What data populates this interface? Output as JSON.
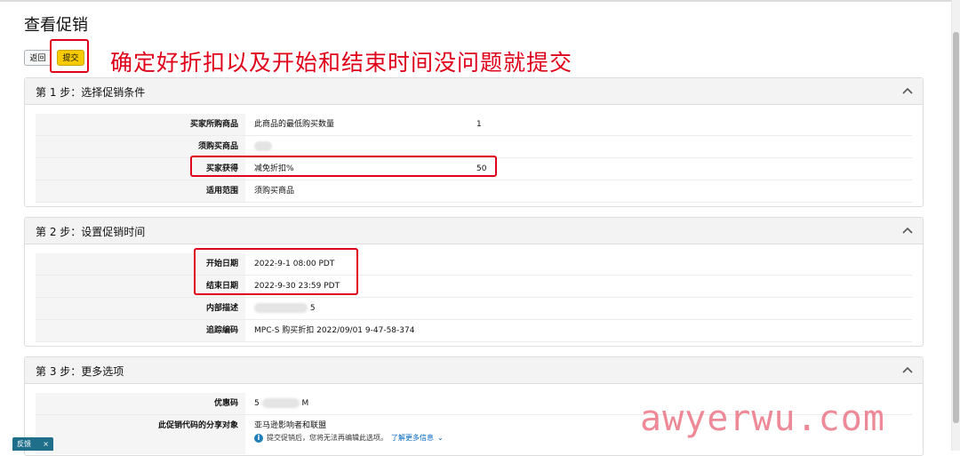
{
  "page": {
    "title": "查看促销",
    "back_label": "返回",
    "submit_label": "提交",
    "annotation": "确定好折扣以及开始和结束时间没问题就提交"
  },
  "step1": {
    "title": "第 1 步：选择促销条件",
    "rows": [
      {
        "label": "买家所购商品",
        "value": "此商品的最低购买数量",
        "value2": "1"
      },
      {
        "label": "须购买商品",
        "value": "",
        "value2": ""
      },
      {
        "label": "买家获得",
        "value": "减免折扣%",
        "value2": "50"
      },
      {
        "label": "适用范围",
        "value": "须购买商品",
        "value2": ""
      }
    ]
  },
  "step2": {
    "title": "第 2 步：设置促销时间",
    "rows": [
      {
        "label": "开始日期",
        "value": "2022-9-1  08:00  PDT"
      },
      {
        "label": "结束日期",
        "value": "2022-9-30  23:59  PDT"
      },
      {
        "label": "内部描述",
        "value": "5"
      },
      {
        "label": "追踪编码",
        "value": "MPC-S 购买折扣 2022/09/01 9-47-58-374"
      }
    ]
  },
  "step3": {
    "title": "第 3 步：更多选项",
    "rows": [
      {
        "label": "优惠码",
        "value_prefix": "5",
        "value_suffix": "M"
      },
      {
        "label": "此促销代码的分享对象",
        "value": "亚马逊影响者和联盟"
      }
    ],
    "info_text": "提交促销后，您将无法再编辑此选项。",
    "learn_more": "了解更多信息"
  },
  "feedback": {
    "label": "反馈",
    "close": "×"
  },
  "watermark": "awyerwu.com",
  "colors": {
    "accent_red": "#e0001a",
    "submit_yellow": "#f7ca00",
    "link_blue": "#0066c0"
  }
}
